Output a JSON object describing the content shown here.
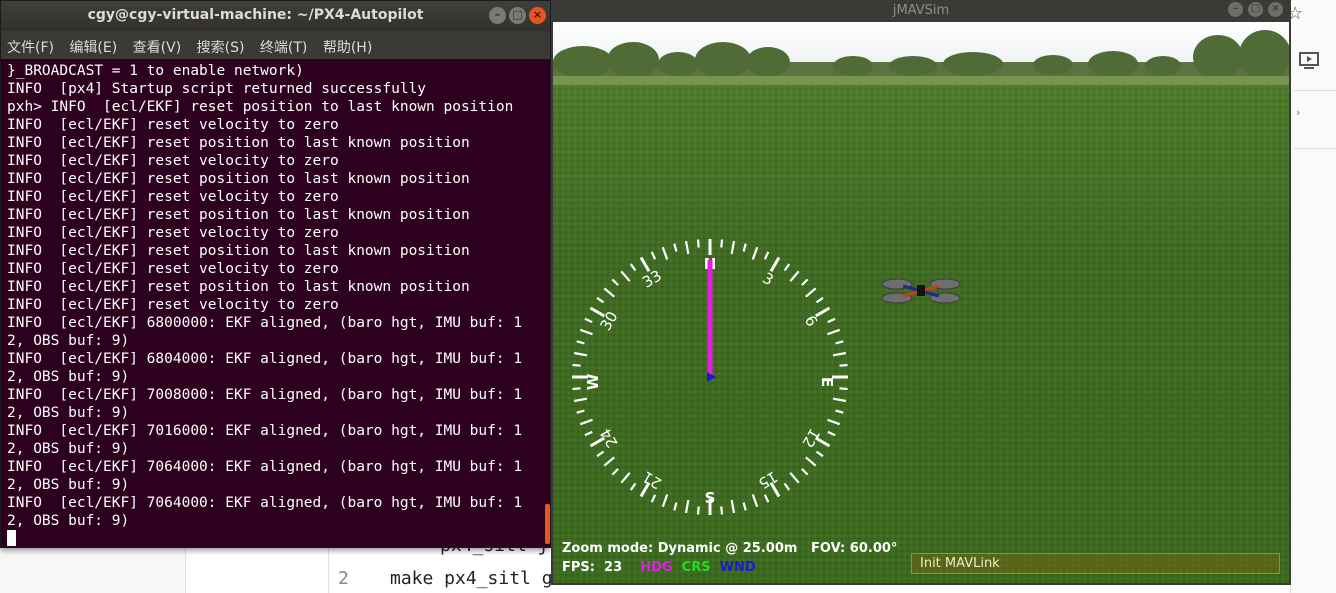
{
  "background_editor": {
    "line1_code": "px4_sitl j",
    "line2_number": "2",
    "line2_code": "make px4_sitl gazebo",
    "bookmark_icon": "star-icon",
    "present_icon": "presentation-icon"
  },
  "terminal": {
    "title": "cgy@cgy-virtual-machine: ~/PX4-Autopilot",
    "menu": [
      "文件(F)",
      "编辑(E)",
      "查看(V)",
      "搜索(S)",
      "终端(T)",
      "帮助(H)"
    ],
    "lines": [
      "}_BROADCAST = 1 to enable network)",
      "INFO  [px4] Startup script returned successfully",
      "pxh> INFO  [ecl/EKF] reset position to last known position",
      "INFO  [ecl/EKF] reset velocity to zero",
      "INFO  [ecl/EKF] reset position to last known position",
      "INFO  [ecl/EKF] reset velocity to zero",
      "INFO  [ecl/EKF] reset position to last known position",
      "INFO  [ecl/EKF] reset velocity to zero",
      "INFO  [ecl/EKF] reset position to last known position",
      "INFO  [ecl/EKF] reset velocity to zero",
      "INFO  [ecl/EKF] reset position to last known position",
      "INFO  [ecl/EKF] reset velocity to zero",
      "INFO  [ecl/EKF] reset position to last known position",
      "INFO  [ecl/EKF] reset velocity to zero",
      "INFO  [ecl/EKF] 6800000: EKF aligned, (baro hgt, IMU buf: 1",
      "2, OBS buf: 9)",
      "INFO  [ecl/EKF] 6804000: EKF aligned, (baro hgt, IMU buf: 1",
      "2, OBS buf: 9)",
      "INFO  [ecl/EKF] 7008000: EKF aligned, (baro hgt, IMU buf: 1",
      "2, OBS buf: 9)",
      "INFO  [ecl/EKF] 7016000: EKF aligned, (baro hgt, IMU buf: 1",
      "2, OBS buf: 9)",
      "INFO  [ecl/EKF] 7064000: EKF aligned, (baro hgt, IMU buf: 1",
      "2, OBS buf: 9)",
      "INFO  [ecl/EKF] 7064000: EKF aligned, (baro hgt, IMU buf: 1",
      "2, OBS buf: 9)"
    ],
    "buttons": {
      "minimize": "–",
      "maximize": "□",
      "close": "×"
    }
  },
  "sim": {
    "title": "jMAVSim",
    "zoom_label": "Zoom mode:",
    "zoom_value": "Dynamic @ 25.00m",
    "fov_label": "FOV:",
    "fov_value": "60.00°",
    "fps_label": "FPS:",
    "fps_value": "23",
    "hdg_label": "HDG",
    "crs_label": "CRS",
    "wnd_label": "WND",
    "status": "Init MAVLink",
    "colors": {
      "hdg": "#e020e0",
      "crs": "#22dd22",
      "wnd": "#1a1ad0",
      "needle": "#e81ce0"
    },
    "compass_labels": {
      "N": "N",
      "E": "E",
      "S": "S",
      "W": "W",
      "3": "3",
      "6": "6",
      "12": "12",
      "15": "15",
      "21": "21",
      "24": "24",
      "30": "30",
      "33": "33"
    },
    "heading_deg": 0,
    "buttons": {
      "minimize": "–",
      "maximize": "□",
      "close": "×"
    }
  }
}
